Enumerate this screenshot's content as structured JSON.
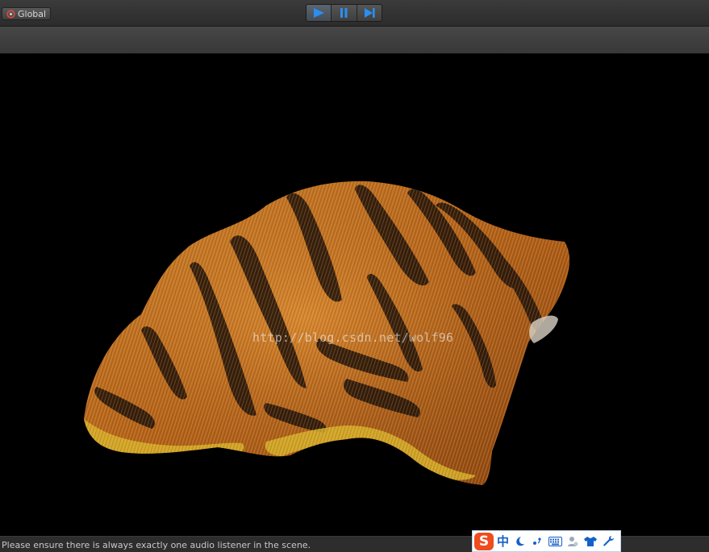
{
  "toolbar": {
    "global_label": "Global",
    "play_label": "Play",
    "pause_label": "Pause",
    "step_label": "Step"
  },
  "scene": {
    "watermark": "http://blog.csdn.net/wolf96",
    "object": "tiger-fur-mesh",
    "fur_colors": {
      "base": "#b8661a",
      "light": "#e39a3a",
      "stripe": "#1e120a",
      "tip": "#d9b52c"
    }
  },
  "status": {
    "message": "Please ensure there is always exactly one audio listener in the scene."
  },
  "ime_bar": {
    "mode_label": "中",
    "icons": [
      "sogou-logo-icon",
      "chinese-mode-icon",
      "moon-icon",
      "punctuation-icon",
      "keyboard-icon",
      "user-icon",
      "skin-shirt-icon",
      "wrench-icon"
    ]
  }
}
